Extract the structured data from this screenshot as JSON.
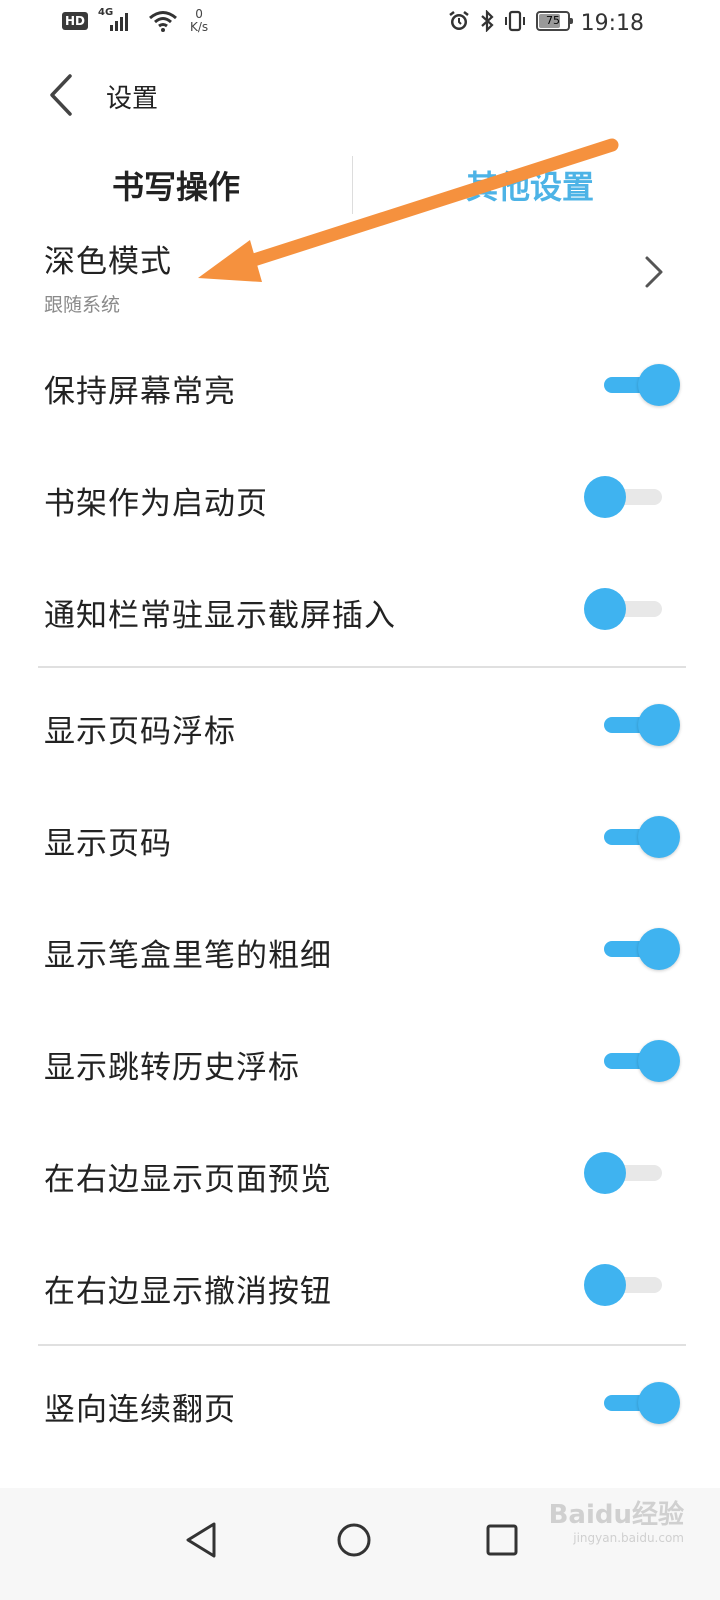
{
  "status_bar": {
    "hd": "HD",
    "network": "4G",
    "speed_value": "0",
    "speed_unit": "K/s",
    "battery_level": "75",
    "time": "19:18",
    "icons": [
      "signal-icon",
      "wifi-icon",
      "alarm-icon",
      "bluetooth-icon",
      "vibrate-icon",
      "battery-icon"
    ]
  },
  "header": {
    "title": "设置",
    "back_icon": "chevron-left-icon"
  },
  "tabs": [
    {
      "label": "书写操作",
      "active": false
    },
    {
      "label": "其他设置",
      "active": true
    }
  ],
  "dark_mode": {
    "label": "深色模式",
    "value": "跟随系统"
  },
  "settings": [
    {
      "label": "保持屏幕常亮",
      "enabled": true
    },
    {
      "label": "书架作为启动页",
      "enabled": false
    },
    {
      "label": "通知栏常驻显示截屏插入",
      "enabled": false
    },
    {
      "label": "显示页码浮标",
      "enabled": true
    },
    {
      "label": "显示页码",
      "enabled": true
    },
    {
      "label": "显示笔盒里笔的粗细",
      "enabled": true
    },
    {
      "label": "显示跳转历史浮标",
      "enabled": true
    },
    {
      "label": "在右边显示页面预览",
      "enabled": false
    },
    {
      "label": "在右边显示撤消按钮",
      "enabled": false
    },
    {
      "label": "竖向连续翻页",
      "enabled": true
    }
  ],
  "colors": {
    "accent": "#3fb3f0",
    "active_tab": "#4db3e6",
    "annotation_arrow": "#f5913e"
  },
  "nav_bar": {
    "icons": [
      "back-triangle-icon",
      "home-circle-icon",
      "recents-square-icon"
    ]
  },
  "watermark": {
    "text": "Baidu经验",
    "domain": "jingyan.baidu.com"
  }
}
